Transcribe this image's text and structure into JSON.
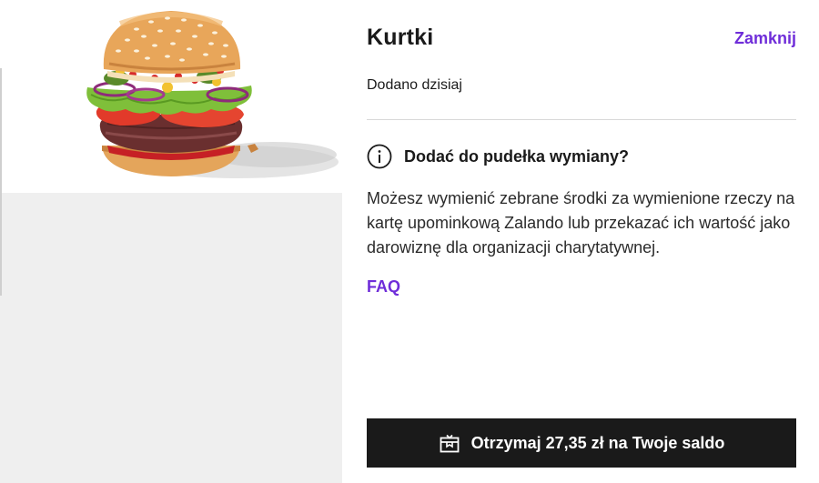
{
  "product": {
    "title": "Kurtki",
    "added_label": "Dodano dzisiaj",
    "image": "burger-product-image"
  },
  "header": {
    "close_label": "Zamknij"
  },
  "exchange_box": {
    "heading": "Dodać do pudełka wymiany?",
    "icon": "info-icon",
    "description": "Możesz wymienić zebrane środki za wymienione rzeczy na kartę upominkową Zalando lub przekazać ich wartość jako darowiznę dla organizacji charytatywnej.",
    "faq_label": "FAQ"
  },
  "action": {
    "button_label": "Otrzymaj 27,35 zł na Twoje saldo",
    "icon": "gift-box-icon"
  },
  "colors": {
    "accent": "#6f2dd9",
    "button_bg": "#1a1a1a",
    "placeholder_bg": "#efefef"
  }
}
